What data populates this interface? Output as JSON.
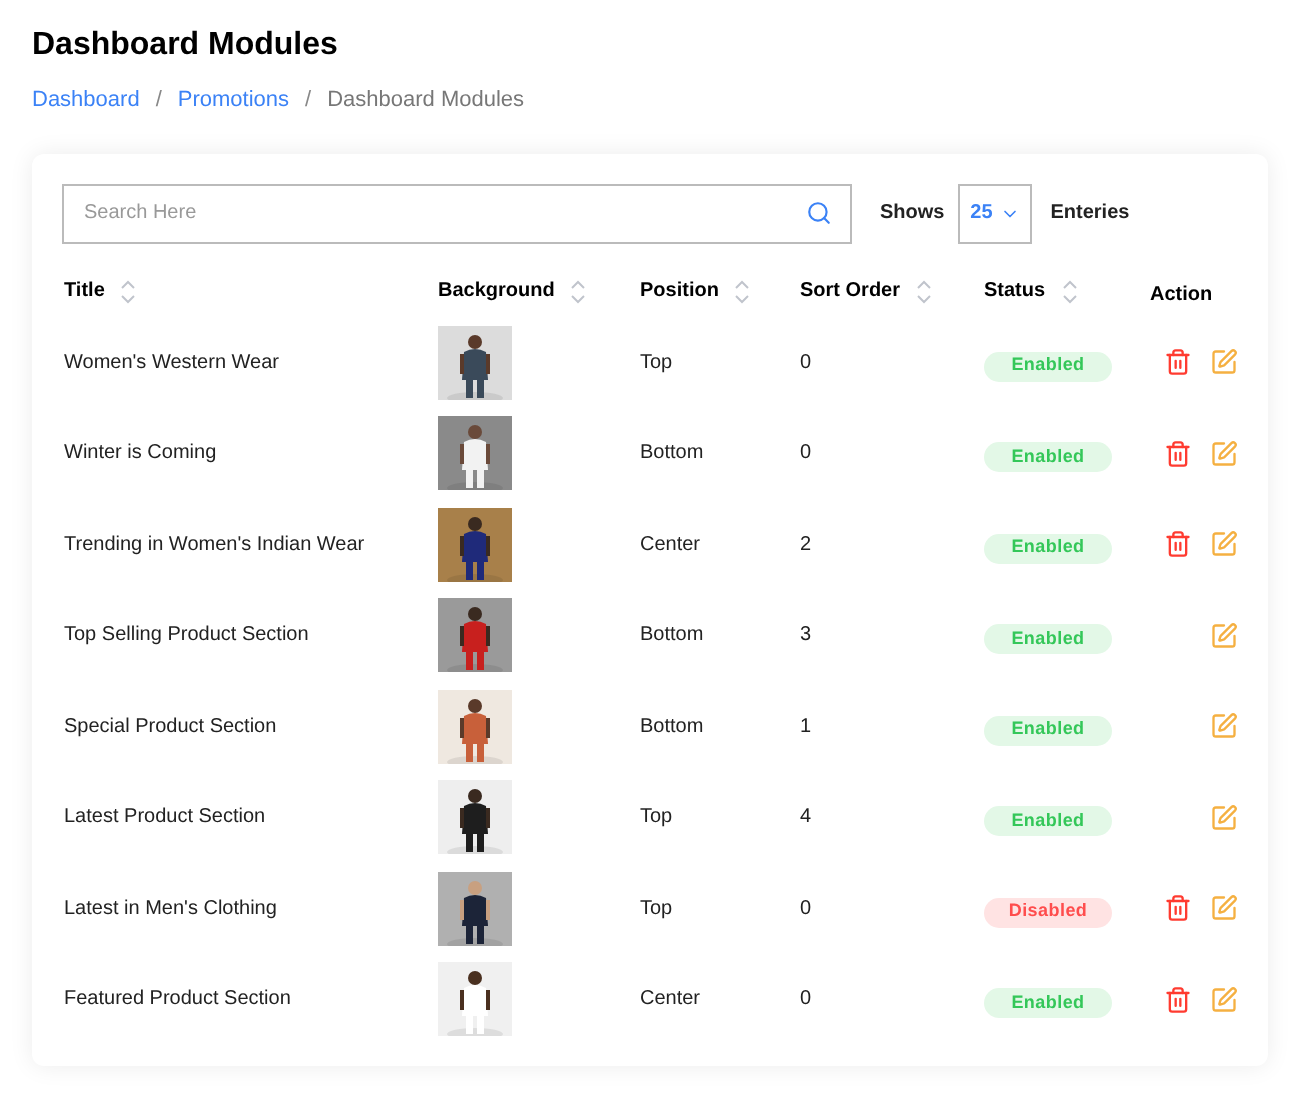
{
  "page_title": "Dashboard Modules",
  "breadcrumb": [
    {
      "kind": "link",
      "label": "Dashboard"
    },
    {
      "kind": "separator",
      "label": "/"
    },
    {
      "kind": "link",
      "label": "Promotions"
    },
    {
      "kind": "separator",
      "label": "/"
    },
    {
      "kind": "current",
      "label": "Dashboard Modules"
    }
  ],
  "search": {
    "placeholder": "Search Here"
  },
  "page_size": {
    "label": "Shows",
    "value": "25",
    "suffix": "Enteries"
  },
  "columns": [
    {
      "label": "Title",
      "sortable": true
    },
    {
      "label": "Background",
      "sortable": true
    },
    {
      "label": "Position",
      "sortable": true
    },
    {
      "label": "Sort Order",
      "sortable": true
    },
    {
      "label": "Status",
      "sortable": true
    },
    {
      "label": "Action",
      "sortable": false
    }
  ],
  "rows": [
    {
      "title": "Women's Western Wear",
      "position": "Top",
      "sort_order": "0",
      "status": {
        "label": "Enabled",
        "kind": "enabled"
      },
      "deletable": true
    },
    {
      "title": "Winter is Coming",
      "position": "Bottom",
      "sort_order": "0",
      "status": {
        "label": "Enabled",
        "kind": "enabled"
      },
      "deletable": true
    },
    {
      "title": "Trending in Women's Indian Wear",
      "position": "Center",
      "sort_order": "2",
      "status": {
        "label": "Enabled",
        "kind": "enabled"
      },
      "deletable": true
    },
    {
      "title": "Top Selling Product Section",
      "position": "Bottom",
      "sort_order": "3",
      "status": {
        "label": "Enabled",
        "kind": "enabled"
      },
      "deletable": false
    },
    {
      "title": "Special Product Section",
      "position": "Bottom",
      "sort_order": "1",
      "status": {
        "label": "Enabled",
        "kind": "enabled"
      },
      "deletable": false
    },
    {
      "title": "Latest Product Section",
      "position": "Top",
      "sort_order": "4",
      "status": {
        "label": "Enabled",
        "kind": "enabled"
      },
      "deletable": false
    },
    {
      "title": "Latest in Men's Clothing",
      "position": "Top",
      "sort_order": "0",
      "status": {
        "label": "Disabled",
        "kind": "disabled"
      },
      "deletable": true
    },
    {
      "title": "Featured Product Section",
      "position": "Center",
      "sort_order": "0",
      "status": {
        "label": "Enabled",
        "kind": "enabled"
      },
      "deletable": true
    }
  ]
}
